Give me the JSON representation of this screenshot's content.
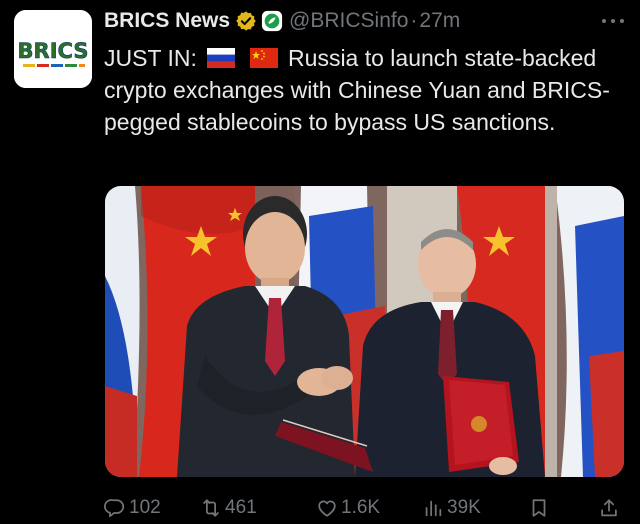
{
  "post": {
    "account_name": "BRICS News",
    "handle": "@BRICSinfo",
    "separator": "·",
    "timestamp": "27m",
    "avatar_text": "BRICS",
    "text_prefix": "JUST IN:",
    "text_body": "Russia to launch state-backed crypto exchanges with Chinese Yuan and BRICS-pegged stablecoins to bypass US sanctions."
  },
  "stats": {
    "replies": "102",
    "reposts": "461",
    "likes": "1.6K",
    "views": "39K"
  },
  "icons": {
    "verified": "gold-verified-check-icon",
    "affiliate": "affiliate-badge-icon",
    "more": "more-horizontal-icon",
    "flag_1": "russia-flag-icon",
    "flag_2": "china-flag-icon",
    "reply": "reply-icon",
    "repost": "repost-icon",
    "like": "heart-icon",
    "views": "views-chart-icon",
    "bookmark": "bookmark-icon",
    "share": "share-icon"
  },
  "colors": {
    "background": "#000000",
    "text": "#e7e9ea",
    "muted": "#71767b",
    "verified_gold": "#e2b719"
  }
}
